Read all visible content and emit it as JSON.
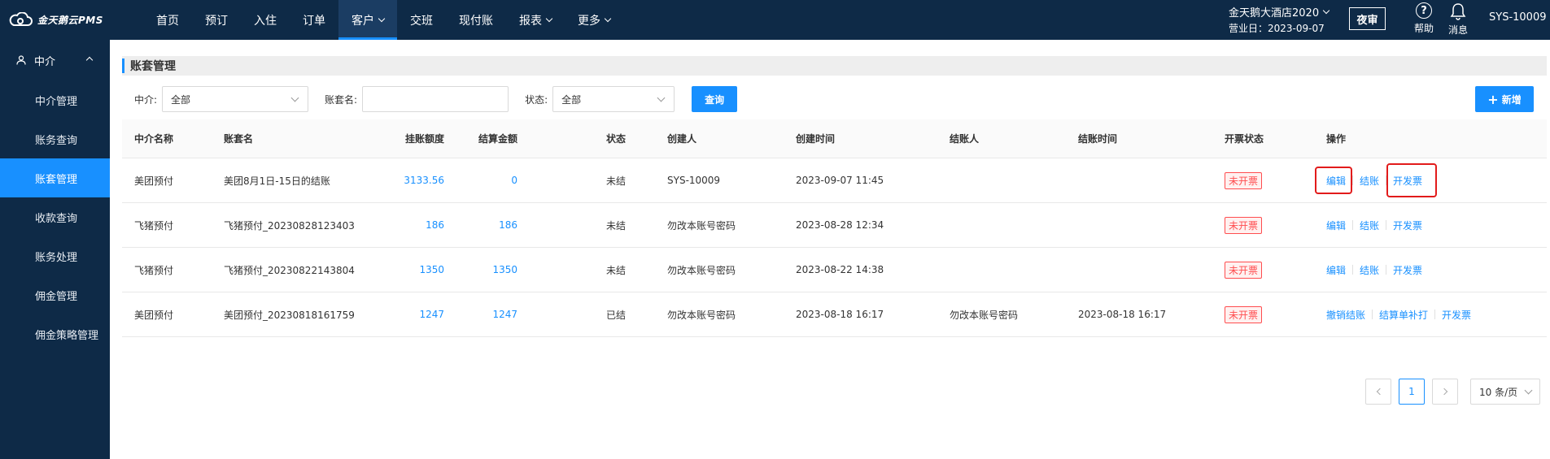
{
  "app": {
    "logo_text": "金天鹅云PMS"
  },
  "nav": {
    "items": [
      {
        "label": "首页",
        "active": false,
        "dropdown": false
      },
      {
        "label": "预订",
        "active": false,
        "dropdown": false
      },
      {
        "label": "入住",
        "active": false,
        "dropdown": false
      },
      {
        "label": "订单",
        "active": false,
        "dropdown": false
      },
      {
        "label": "客户",
        "active": true,
        "dropdown": true
      },
      {
        "label": "交班",
        "active": false,
        "dropdown": false
      },
      {
        "label": "现付账",
        "active": false,
        "dropdown": false
      },
      {
        "label": "报表",
        "active": false,
        "dropdown": true
      },
      {
        "label": "更多",
        "active": false,
        "dropdown": true
      }
    ]
  },
  "header": {
    "hotel_name": "金天鹅大酒店2020",
    "business_date": "营业日：2023-09-07",
    "night_audit": "夜审",
    "help": "帮助",
    "messages": "消息",
    "user": "SYS-10009"
  },
  "sidebar": {
    "section": "中介",
    "items": [
      {
        "label": "中介管理",
        "active": false
      },
      {
        "label": "账务查询",
        "active": false
      },
      {
        "label": "账套管理",
        "active": true
      },
      {
        "label": "收款查询",
        "active": false
      },
      {
        "label": "账务处理",
        "active": false
      },
      {
        "label": "佣金管理",
        "active": false
      },
      {
        "label": "佣金策略管理",
        "active": false
      }
    ]
  },
  "page": {
    "title": "账套管理"
  },
  "filters": {
    "agent_label": "中介:",
    "agent_value": "全部",
    "account_label": "账套名:",
    "account_value": "",
    "status_label": "状态:",
    "status_value": "全部",
    "query_button": "查询",
    "add_button": "新增"
  },
  "table": {
    "headers": [
      "中介名称",
      "账套名",
      "挂账额度",
      "结算金额",
      "状态",
      "创建人",
      "创建时间",
      "结账人",
      "结账时间",
      "开票状态",
      "操作"
    ],
    "rows": [
      {
        "agent": "美团预付",
        "account": "美团8月1日-15日的结账",
        "credit": "3133.56",
        "settle": "0",
        "status": "未结",
        "creator": "SYS-10009",
        "created": "2023-09-07 11:45",
        "closer": "",
        "closed": "",
        "invoice": "未开票",
        "ops": [
          "编辑",
          "结账",
          "开发票"
        ]
      },
      {
        "agent": "飞猪预付",
        "account": "飞猪预付_20230828123403",
        "credit": "186",
        "settle": "186",
        "status": "未结",
        "creator": "勿改本账号密码",
        "created": "2023-08-28 12:34",
        "closer": "",
        "closed": "",
        "invoice": "未开票",
        "ops": [
          "编辑",
          "结账",
          "开发票"
        ]
      },
      {
        "agent": "飞猪预付",
        "account": "飞猪预付_20230822143804",
        "credit": "1350",
        "settle": "1350",
        "status": "未结",
        "creator": "勿改本账号密码",
        "created": "2023-08-22 14:38",
        "closer": "",
        "closed": "",
        "invoice": "未开票",
        "ops": [
          "编辑",
          "结账",
          "开发票"
        ]
      },
      {
        "agent": "美团预付",
        "account": "美团预付_20230818161759",
        "credit": "1247",
        "settle": "1247",
        "status": "已结",
        "creator": "勿改本账号密码",
        "created": "2023-08-18 16:17",
        "closer": "勿改本账号密码",
        "closed": "2023-08-18 16:17",
        "invoice": "未开票",
        "ops": [
          "撤销结账",
          "结算单补打",
          "开发票"
        ]
      }
    ]
  },
  "pagination": {
    "current_page": "1",
    "page_size": "10 条/页"
  },
  "colors": {
    "nav_bg": "#0e2a47",
    "accent": "#1890ff",
    "danger": "#ff4d4f",
    "highlight_box": "#e21b1b"
  }
}
